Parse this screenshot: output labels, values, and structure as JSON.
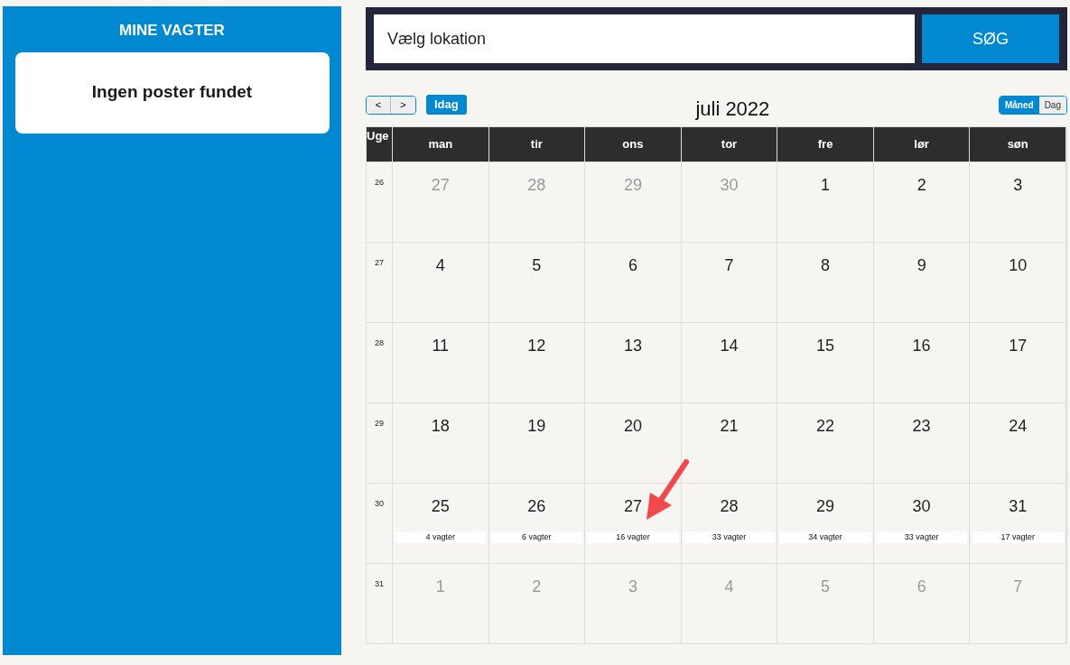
{
  "sidebar": {
    "title": "MINE VAGTER",
    "empty_message": "Ingen poster fundet"
  },
  "search": {
    "placeholder": "Vælg lokation",
    "button": "SØG"
  },
  "toolbar": {
    "prev": "<",
    "next": ">",
    "today": "Idag",
    "title": "juli 2022",
    "views": [
      {
        "label": "Måned",
        "selected": true
      },
      {
        "label": "Dag",
        "selected": false
      }
    ]
  },
  "calendar": {
    "week_header": "Uge",
    "days": [
      "man",
      "tir",
      "ons",
      "tor",
      "fre",
      "lør",
      "søn"
    ],
    "weeks": [
      {
        "number": "26",
        "days": [
          {
            "date": "27",
            "other_month": true
          },
          {
            "date": "28",
            "other_month": true
          },
          {
            "date": "29",
            "other_month": true
          },
          {
            "date": "30",
            "other_month": true
          },
          {
            "date": "1",
            "other_month": false
          },
          {
            "date": "2",
            "other_month": false
          },
          {
            "date": "3",
            "other_month": false
          }
        ]
      },
      {
        "number": "27",
        "days": [
          {
            "date": "4",
            "other_month": false
          },
          {
            "date": "5",
            "other_month": false
          },
          {
            "date": "6",
            "other_month": false
          },
          {
            "date": "7",
            "other_month": false
          },
          {
            "date": "8",
            "other_month": false
          },
          {
            "date": "9",
            "other_month": false
          },
          {
            "date": "10",
            "other_month": false
          }
        ]
      },
      {
        "number": "28",
        "days": [
          {
            "date": "11",
            "other_month": false
          },
          {
            "date": "12",
            "other_month": false
          },
          {
            "date": "13",
            "other_month": false
          },
          {
            "date": "14",
            "other_month": false
          },
          {
            "date": "15",
            "other_month": false
          },
          {
            "date": "16",
            "other_month": false
          },
          {
            "date": "17",
            "other_month": false
          }
        ]
      },
      {
        "number": "29",
        "days": [
          {
            "date": "18",
            "other_month": false
          },
          {
            "date": "19",
            "other_month": false
          },
          {
            "date": "20",
            "other_month": false
          },
          {
            "date": "21",
            "other_month": false
          },
          {
            "date": "22",
            "other_month": false
          },
          {
            "date": "23",
            "other_month": false
          },
          {
            "date": "24",
            "other_month": false
          }
        ]
      },
      {
        "number": "30",
        "days": [
          {
            "date": "25",
            "other_month": false,
            "event": "4 vagter"
          },
          {
            "date": "26",
            "other_month": false,
            "event": "6 vagter"
          },
          {
            "date": "27",
            "other_month": false,
            "event": "16 vagter"
          },
          {
            "date": "28",
            "other_month": false,
            "event": "33 vagter"
          },
          {
            "date": "29",
            "other_month": false,
            "event": "34 vagter"
          },
          {
            "date": "30",
            "other_month": false,
            "event": "33 vagter"
          },
          {
            "date": "31",
            "other_month": false,
            "event": "17 vagter"
          }
        ]
      },
      {
        "number": "31",
        "days": [
          {
            "date": "1",
            "other_month": true
          },
          {
            "date": "2",
            "other_month": true
          },
          {
            "date": "3",
            "other_month": true
          },
          {
            "date": "4",
            "other_month": true
          },
          {
            "date": "5",
            "other_month": true
          },
          {
            "date": "6",
            "other_month": true
          },
          {
            "date": "7",
            "other_month": true
          }
        ]
      }
    ]
  }
}
